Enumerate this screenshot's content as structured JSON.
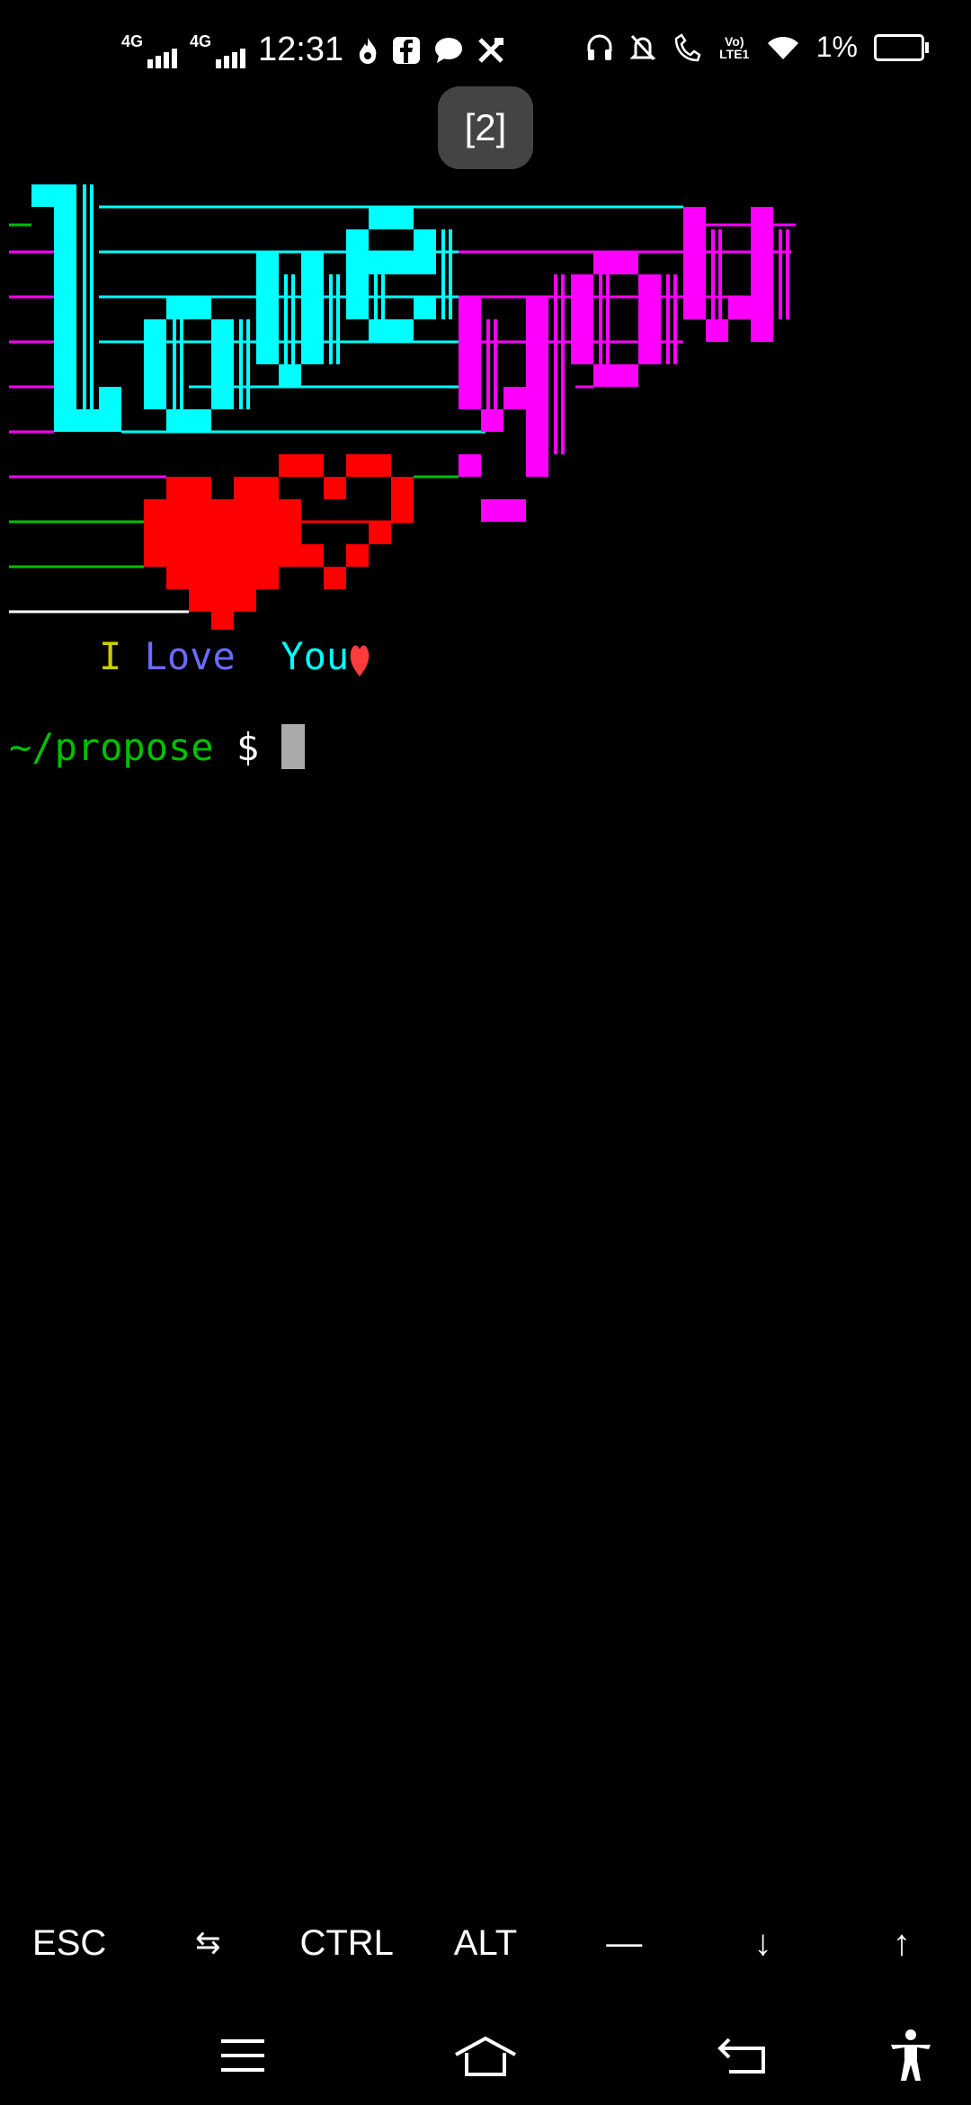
{
  "status": {
    "net1": "4G",
    "net2": "4G",
    "time": "12:31",
    "volte": "Vo) LTE1",
    "battery": "1%"
  },
  "toast": {
    "label": "[2]"
  },
  "tagline": {
    "w1": "I",
    "w2": "Love",
    "w3": "You"
  },
  "prompt": {
    "path": "~/propose",
    "symbol": "$"
  },
  "extra_keys": {
    "esc": "ESC",
    "tab": "⇆",
    "ctrl": "CTRL",
    "alt": "ALT",
    "dash": "—",
    "down": "↓",
    "up": "↑"
  },
  "colors": {
    "cyan": "#00ffff",
    "magenta": "#ff00ff",
    "red": "#ff0000",
    "green": "#00c000",
    "yellow": "#cccc00",
    "blue": "#6a6aff"
  }
}
